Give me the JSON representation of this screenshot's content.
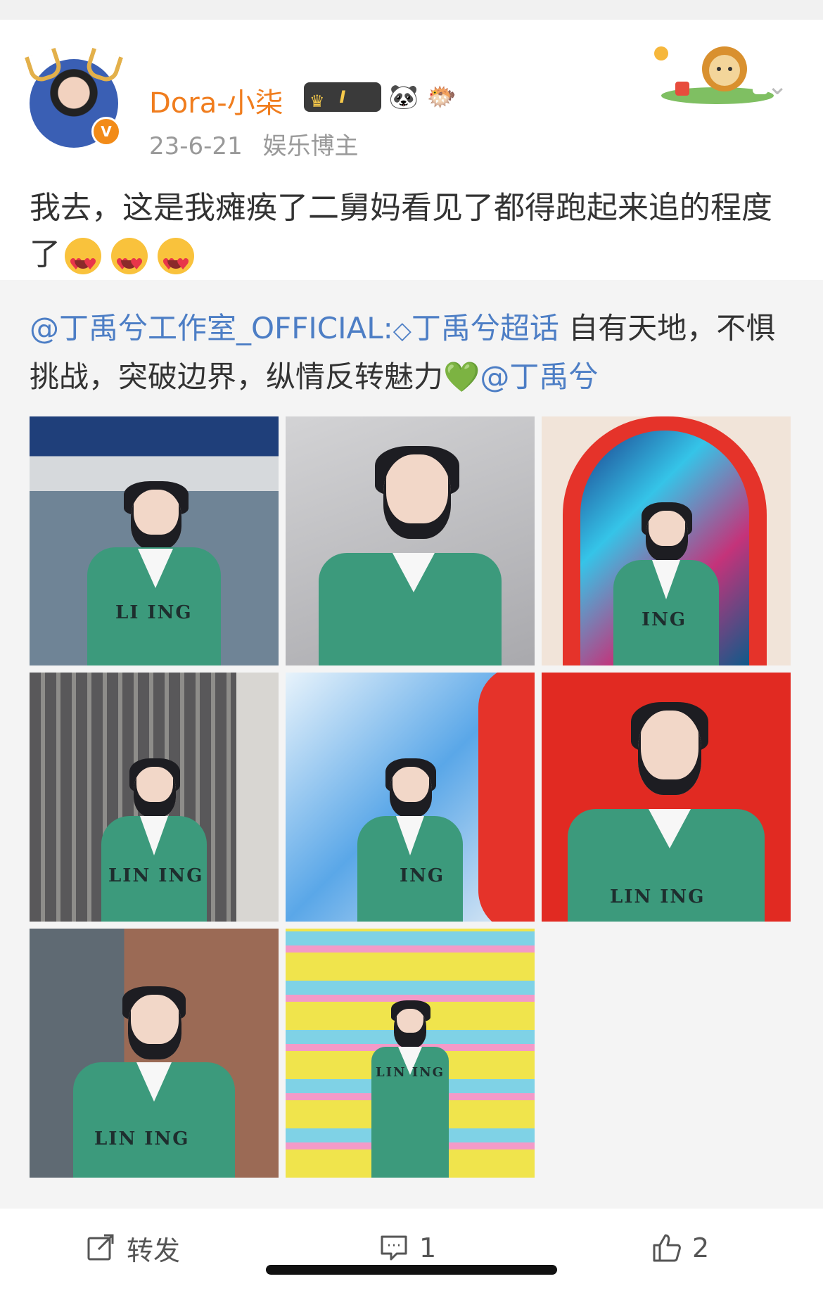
{
  "post": {
    "username": "Dora-小柒",
    "level_badge": "I",
    "date": "23-6-21",
    "role": "娱乐博主",
    "text": "我去，这是我瘫痪了二舅妈看见了都得跑起来追的程度了",
    "emojis": [
      "heart-eyes-emoji",
      "heart-eyes-emoji",
      "heart-eyes-emoji"
    ]
  },
  "repost": {
    "author_link": "@丁禹兮工作室_OFFICIAL:",
    "topic_link": "丁禹兮超话",
    "text": " 自有天地，不惧挑战，突破边界，纵情反转魅力",
    "mention": "@丁禹兮",
    "images": [
      {
        "desc": "station",
        "bg": "#8aa0b4",
        "logo": "LI ING"
      },
      {
        "desc": "closeup",
        "bg": "#c9c9cb",
        "logo": ""
      },
      {
        "desc": "red-arch",
        "bg": "#f0e3d8",
        "logo": "ING"
      },
      {
        "desc": "fence",
        "bg": "#8b8a86",
        "logo": "LIN ING"
      },
      {
        "desc": "blue-swirl",
        "bg": "#cfe3f4",
        "logo": "ING"
      },
      {
        "desc": "red-wall",
        "bg": "#e4241e",
        "logo": "LIN ING"
      },
      {
        "desc": "brick",
        "bg": "#9a6a56",
        "logo": "LIN ING"
      },
      {
        "desc": "poster",
        "bg": "#f1e85a",
        "logo": "LIN ING"
      }
    ]
  },
  "actions": {
    "repost_label": "转发",
    "comment_count": "1",
    "like_count": "2"
  }
}
